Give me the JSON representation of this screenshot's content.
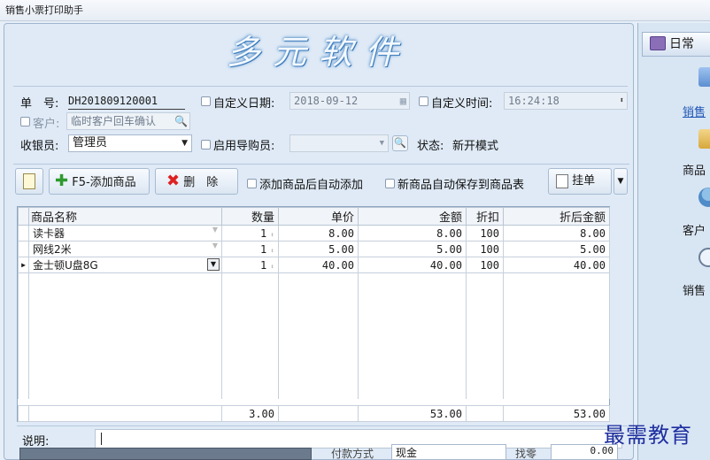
{
  "window": {
    "title": "销售小票打印助手"
  },
  "banner": {
    "text": "多元软件"
  },
  "info": {
    "order_no_label": "单　号:",
    "order_no": "DH201809120001",
    "custom_date_label": "自定义日期:",
    "custom_date": "2018-09-12",
    "custom_time_label": "自定义时间:",
    "custom_time": "16:24:18",
    "customer_label": "客户:",
    "customer_value": "临时客户回车确认",
    "cashier_label": "收银员:",
    "cashier_value": "管理员",
    "guide_label": "启用导购员:",
    "status_label": "状态:",
    "status_value": "新开模式"
  },
  "toolbar": {
    "add_label": "F5-添加商品",
    "delete_label": "删　除",
    "auto_add_label": "添加商品后自动添加",
    "auto_save_label": "新商品自动保存到商品表",
    "hold_label": "挂单"
  },
  "table": {
    "columns": [
      "商品名称",
      "数量",
      "单价",
      "金额",
      "折扣",
      "折后金额"
    ],
    "rows": [
      {
        "name": "读卡器",
        "qty": "1",
        "price": "8.00",
        "amount": "8.00",
        "discount": "100",
        "final": "8.00"
      },
      {
        "name": "网线2米",
        "qty": "1",
        "price": "5.00",
        "amount": "5.00",
        "discount": "100",
        "final": "5.00"
      },
      {
        "name": "金士顿U盘8G",
        "qty": "1",
        "price": "40.00",
        "amount": "40.00",
        "discount": "100",
        "final": "40.00"
      }
    ],
    "totals": {
      "qty": "3.00",
      "amount": "53.00",
      "final": "53.00"
    }
  },
  "note": {
    "label": "说明:"
  },
  "right_panel": {
    "tab_label": "日常",
    "items": [
      "销售",
      "商品",
      "客户",
      "销售"
    ]
  },
  "bottom": {
    "pay_label": "付款方式",
    "pay_value": "现金",
    "change_label": "找零",
    "change_value": "0.00"
  },
  "watermark": {
    "text": "最需教育"
  }
}
